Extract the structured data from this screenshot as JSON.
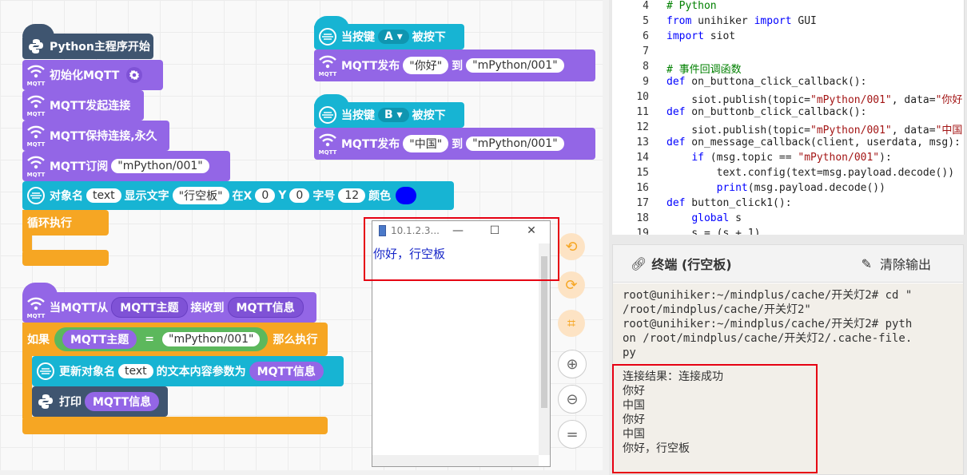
{
  "blocks": {
    "main_start": "Python主程序开始",
    "init_mqtt": "初始化MQTT",
    "mqtt_connect": "MQTT发起连接",
    "mqtt_keep": "MQTT保持连接,永久",
    "mqtt_subscribe": "MQTT订阅",
    "subscribe_topic": "\"mPython/001\"",
    "object_name_label": "对象名",
    "object_name": "text",
    "show_text_label": "显示文字",
    "show_text": "\"行空板\"",
    "in_x": "在X",
    "x": "0",
    "y_label": "Y",
    "y": "0",
    "font_size_label": "字号",
    "font_size": "12",
    "color_label": "颜色",
    "loop": "循环执行",
    "mqtt_label": "MQTT",
    "on_key_a_prefix": "当按键",
    "key_a": "A",
    "on_key_suffix": "被按下",
    "publish_label": "MQTT发布",
    "publish_a_msg": "\"你好\"",
    "to_label": "到",
    "publish_a_topic": "\"mPython/001\"",
    "key_b": "B",
    "publish_b_msg": "\"中国\"",
    "publish_b_topic": "\"mPython/001\"",
    "on_mqtt_from": "当MQTT从",
    "mqtt_topic": "MQTT主题",
    "received": "接收到",
    "mqtt_message": "MQTT信息",
    "if_label": "如果",
    "equals": "=",
    "if_value": "\"mPython/001\"",
    "then_label": "那么执行",
    "update_obj_label": "更新对象名",
    "update_obj_name": "text",
    "update_suffix": "的文本内容参数为",
    "print_label": "打印",
    "dropdown_arrow": "▾"
  },
  "window": {
    "title": "10.1.2.3...",
    "minimize": "—",
    "maximize": "☐",
    "close": "✕",
    "message": "你好，行空板"
  },
  "code": {
    "lines": [
      {
        "n": "4",
        "t": "# Python"
      },
      {
        "n": "5",
        "t": "from unihiker import GUI"
      },
      {
        "n": "6",
        "t": "import siot"
      },
      {
        "n": "7",
        "t": ""
      },
      {
        "n": "8",
        "t": "# 事件回调函数"
      },
      {
        "n": "9",
        "t": "def on_buttona_click_callback():"
      },
      {
        "n": "10",
        "t": "    siot.publish(topic=\"mPython/001\", data=\"你好\""
      },
      {
        "n": "11",
        "t": "def on_buttonb_click_callback():"
      },
      {
        "n": "12",
        "t": "    siot.publish(topic=\"mPython/001\", data=\"中国\""
      },
      {
        "n": "13",
        "t": "def on_message_callback(client, userdata, msg):"
      },
      {
        "n": "14",
        "t": "    if (msg.topic == \"mPython/001\"):"
      },
      {
        "n": "15",
        "t": "        text.config(text=msg.payload.decode())"
      },
      {
        "n": "16",
        "t": "        print(msg.payload.decode())"
      },
      {
        "n": "17",
        "t": "def button_click1():"
      },
      {
        "n": "18",
        "t": "    global s"
      },
      {
        "n": "19",
        "t": "    s = (s + 1)"
      }
    ]
  },
  "terminal": {
    "title": "终端 (行空板)",
    "clear": "清除输出",
    "line1": "root@unihiker:~/mindplus/cache/开关灯2# cd \"",
    "line2": "/root/mindplus/cache/开关灯2\"",
    "line3": "root@unihiker:~/mindplus/cache/开关灯2# pyth",
    "line4": "on /root/mindplus/cache/开关灯2/.cache-file.",
    "line5": "py",
    "output": [
      "连接结果：连接成功",
      "你好",
      "中国",
      "你好",
      "中国",
      "你好，行空板"
    ]
  },
  "colors": {
    "python_block": "#3f5570",
    "mqtt_block": "#9366e6",
    "visual_block": "#17b4d3",
    "control_block": "#f6a623",
    "highlight": "#e60012",
    "text_color_swatch": "#0000ff"
  },
  "icons": {
    "python": "python-logo-icon",
    "wifi": "wifi-icon",
    "settings": "gear-icon",
    "undo": "undo-icon",
    "redo": "redo-icon",
    "crop": "crop-icon",
    "zoom_in": "zoom-in-icon",
    "zoom_out": "zoom-out-icon",
    "reset": "equals-icon",
    "terminal": "link-icon",
    "clear": "eraser-icon"
  }
}
